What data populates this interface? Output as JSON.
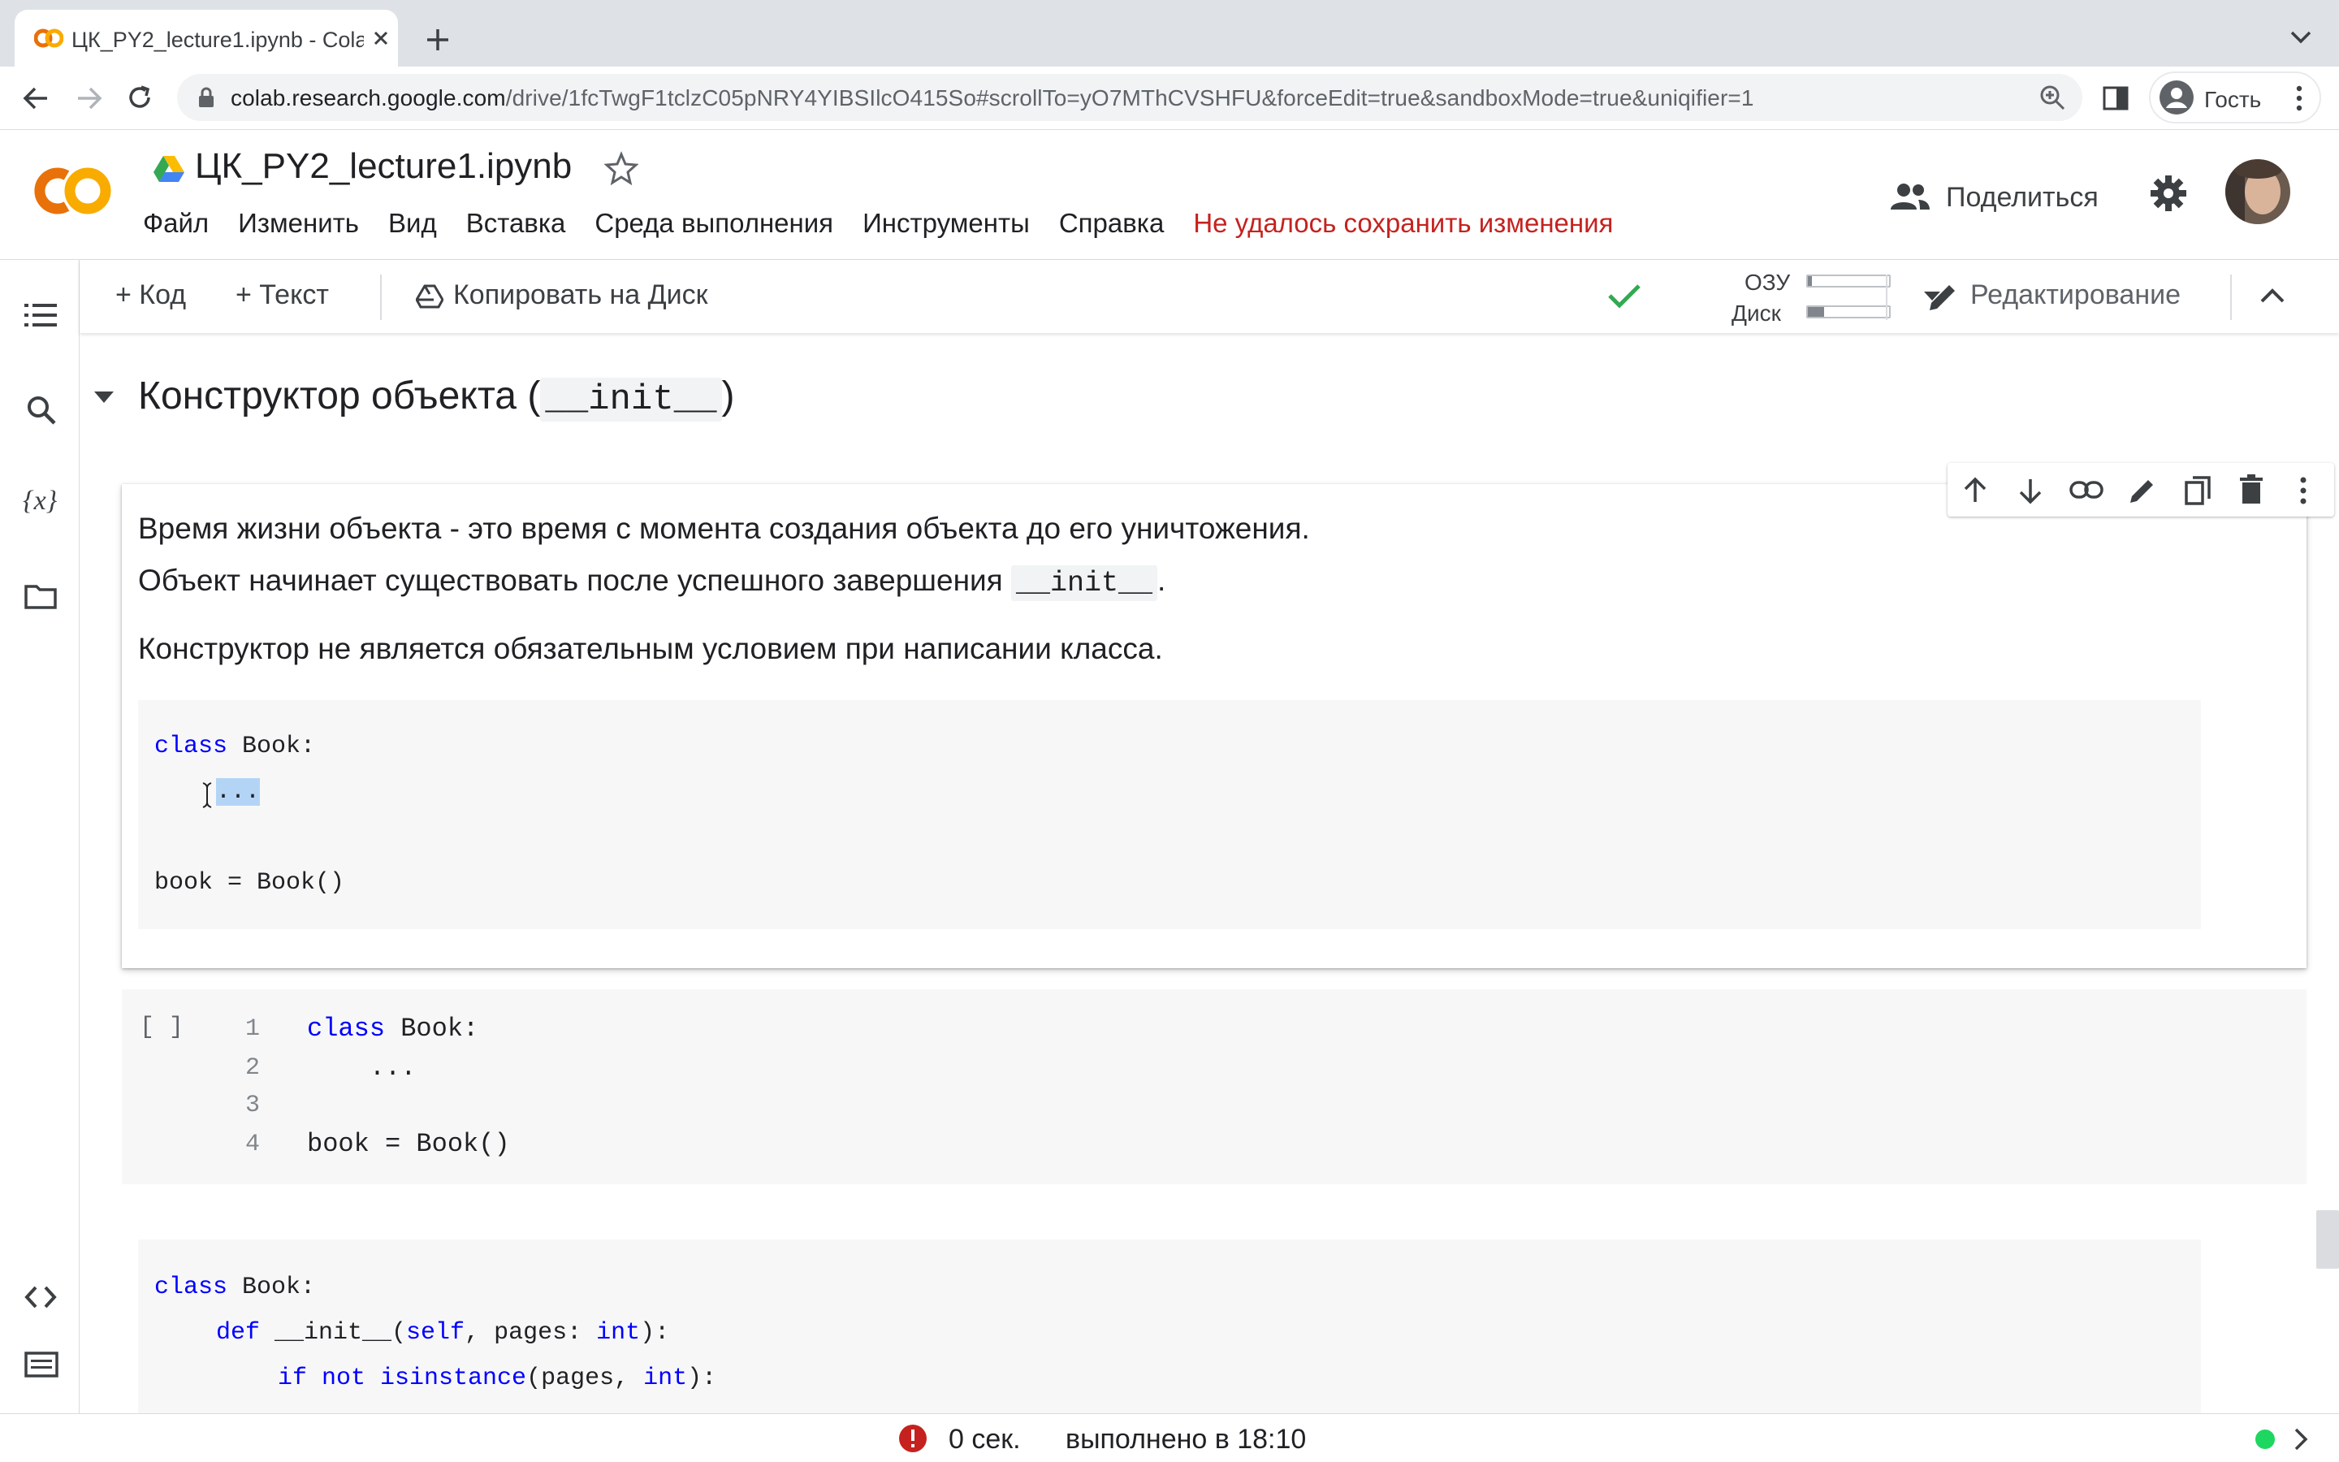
{
  "browser": {
    "tab_title": "ЦК_PY2_lecture1.ipynb - Colab",
    "url_host": "colab.research.google.com",
    "url_path": "/drive/1fcTwgF1tclzC05pNRY4YIBSIlcO415So#scrollTo=yO7MThCVSHFU&forceEdit=true&sandboxMode=true&uniqifier=1",
    "profile_label": "Гость"
  },
  "header": {
    "logo_text": "CO",
    "notebook_title": "ЦК_PY2_lecture1.ipynb",
    "menu": [
      "Файл",
      "Изменить",
      "Вид",
      "Вставка",
      "Среда выполнения",
      "Инструменты",
      "Справка"
    ],
    "save_error": "Не удалось сохранить изменения",
    "share_label": "Поделиться"
  },
  "toolbar": {
    "add_code": "+ Код",
    "add_text": "+ Текст",
    "copy_to_drive": "Копировать на Диск",
    "ram_label": "ОЗУ",
    "disk_label": "Диск",
    "ram_usage": 0.05,
    "disk_usage": 0.2,
    "edit_mode": "Редактирование"
  },
  "section": {
    "title_prefix": "Конструктор объекта (",
    "title_code": "__init__",
    "title_suffix": ")"
  },
  "text_cell": {
    "p1": "Время жизни объекта - это время с момента создания объекта до его уничтожения.",
    "p2_prefix": "Объект начинает существовать после успешного завершения ",
    "p2_code": "__init__",
    "p2_suffix": ".",
    "p3": "Конструктор не является обязательным условием при написании класса.",
    "code": {
      "l1_kw": "class",
      "l1_rest": " Book:",
      "l2": "...",
      "l4": "book = Book()"
    }
  },
  "code_cell": {
    "run_indicator": "[ ]",
    "line_numbers": [
      "1",
      "2",
      "3",
      "4"
    ],
    "l1_kw": "class",
    "l1_rest": " Book:",
    "l2": "    ...",
    "l4": "book = Book()"
  },
  "next_block": {
    "l1_kw": "class",
    "l1_rest": " Book:",
    "l2_kw": "def",
    "l2_fn": " __init__(",
    "l2_self": "self",
    "l2_mid": ", pages: ",
    "l2_type": "int",
    "l2_end": "):",
    "l3_kw1": "if",
    "l3_kw2": " not",
    "l3_fn": " isinstance",
    "l3_mid": "(pages, ",
    "l3_type": "int",
    "l3_end": "):"
  },
  "status": {
    "time": "0 сек.",
    "done": "выполнено в 18:10"
  },
  "colors": {
    "accent_orange": "#f9ab00",
    "error_red": "#c5221f",
    "check_green": "#34a853",
    "keyword_blue": "#0000ff"
  }
}
